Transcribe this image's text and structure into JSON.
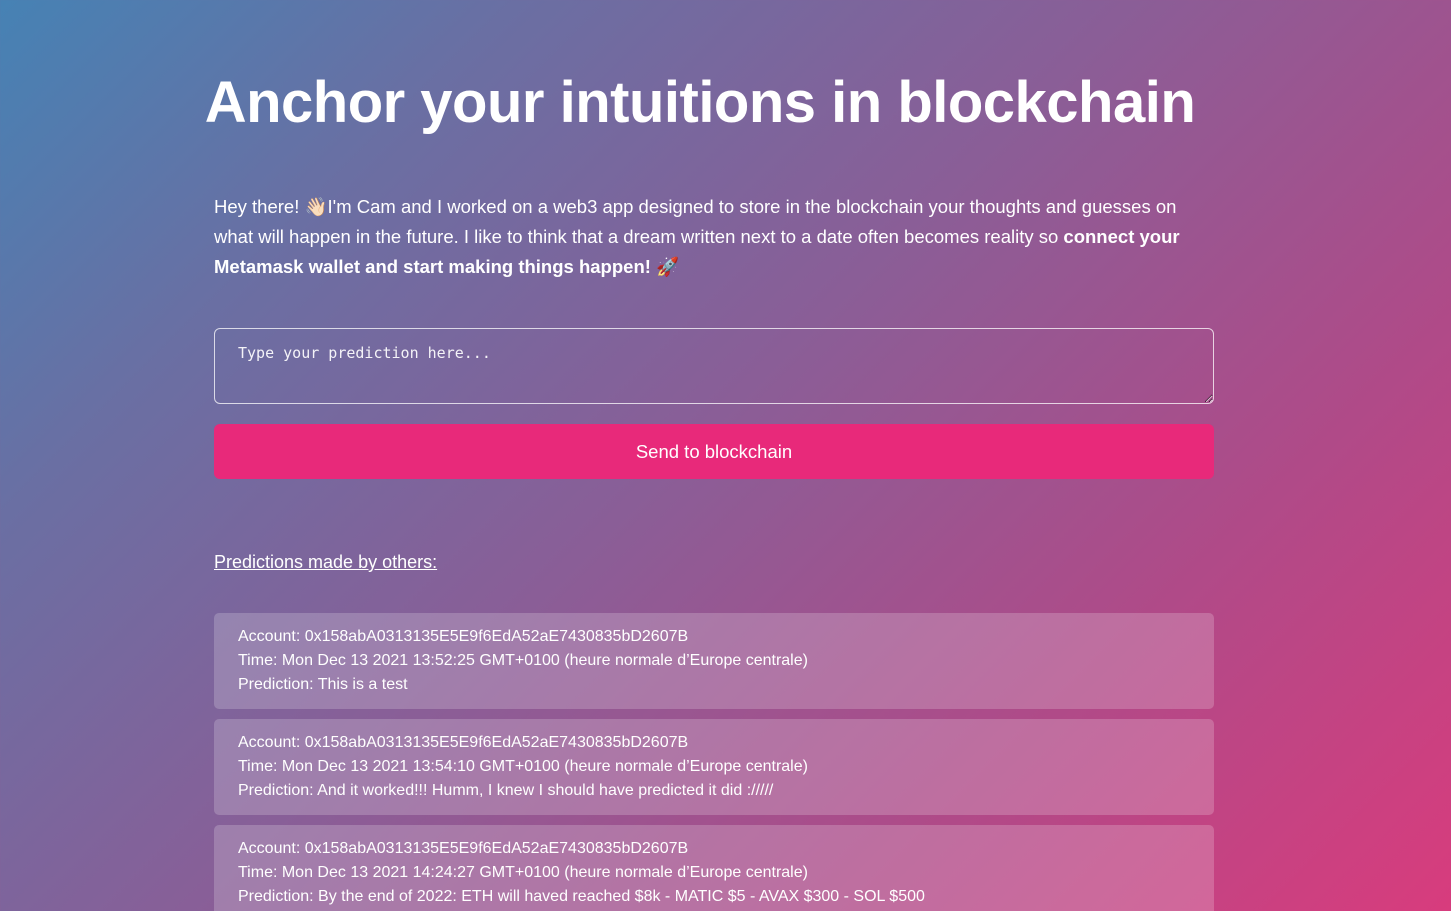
{
  "header": {
    "title": "Anchor your intuitions in blockchain"
  },
  "intro": {
    "text": "Hey there! 👋🏻I'm Cam and I worked on a web3 app designed to store in the blockchain your thoughts and guesses on what will happen in the future. I like to think that a dream written next to a date often becomes reality so ",
    "bold_text": "connect your Metamask wallet and start making things happen!",
    "emoji": " 🚀"
  },
  "form": {
    "placeholder": "Type your prediction here...",
    "value": "",
    "submit_label": "Send to blockchain"
  },
  "others": {
    "heading": "Predictions made by others:",
    "items": [
      {
        "account": "Account: 0x158abA0313135E5E9f6EdA52aE7430835bD2607B",
        "time": "Time: Mon Dec 13 2021 13:52:25 GMT+0100 (heure normale d’Europe centrale)",
        "prediction": "Prediction: This is a test"
      },
      {
        "account": "Account: 0x158abA0313135E5E9f6EdA52aE7430835bD2607B",
        "time": "Time: Mon Dec 13 2021 13:54:10 GMT+0100 (heure normale d’Europe centrale)",
        "prediction": "Prediction: And it worked!!! Humm, I knew I should have predicted it did ://///"
      },
      {
        "account": "Account: 0x158abA0313135E5E9f6EdA52aE7430835bD2607B",
        "time": "Time: Mon Dec 13 2021 14:24:27 GMT+0100 (heure normale d’Europe centrale)",
        "prediction": "Prediction: By the end of 2022: ETH will haved reached $8k - MATIC $5 - AVAX $300 - SOL $500"
      }
    ]
  },
  "colors": {
    "accent": "#e8297a",
    "gradient_start": "#4682b4",
    "gradient_end": "#d83c7d"
  }
}
